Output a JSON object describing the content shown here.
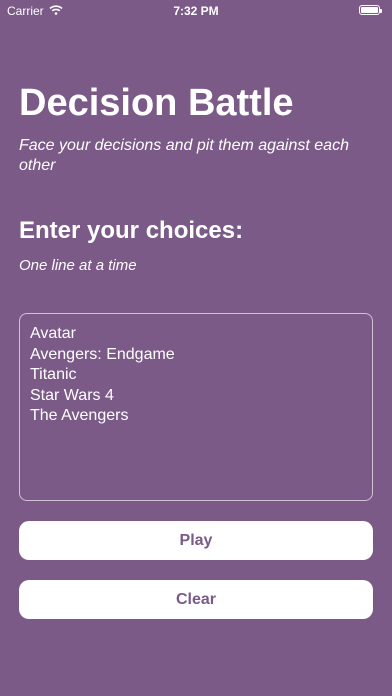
{
  "status_bar": {
    "carrier": "Carrier",
    "time": "7:32 PM",
    "battery_level": 1.0
  },
  "header": {
    "title": "Decision Battle",
    "subtitle": "Face your decisions and pit them against each other"
  },
  "choices_section": {
    "heading": "Enter your choices:",
    "hint": "One line at a time",
    "lines": [
      "Avatar",
      "Avengers: Endgame",
      "Titanic",
      "Star Wars 4",
      "The Avengers"
    ]
  },
  "actions": {
    "play_label": "Play",
    "clear_label": "Clear"
  },
  "colors": {
    "background": "#7b5a88",
    "button_background": "#ffffff",
    "button_text": "#7b5a88"
  }
}
